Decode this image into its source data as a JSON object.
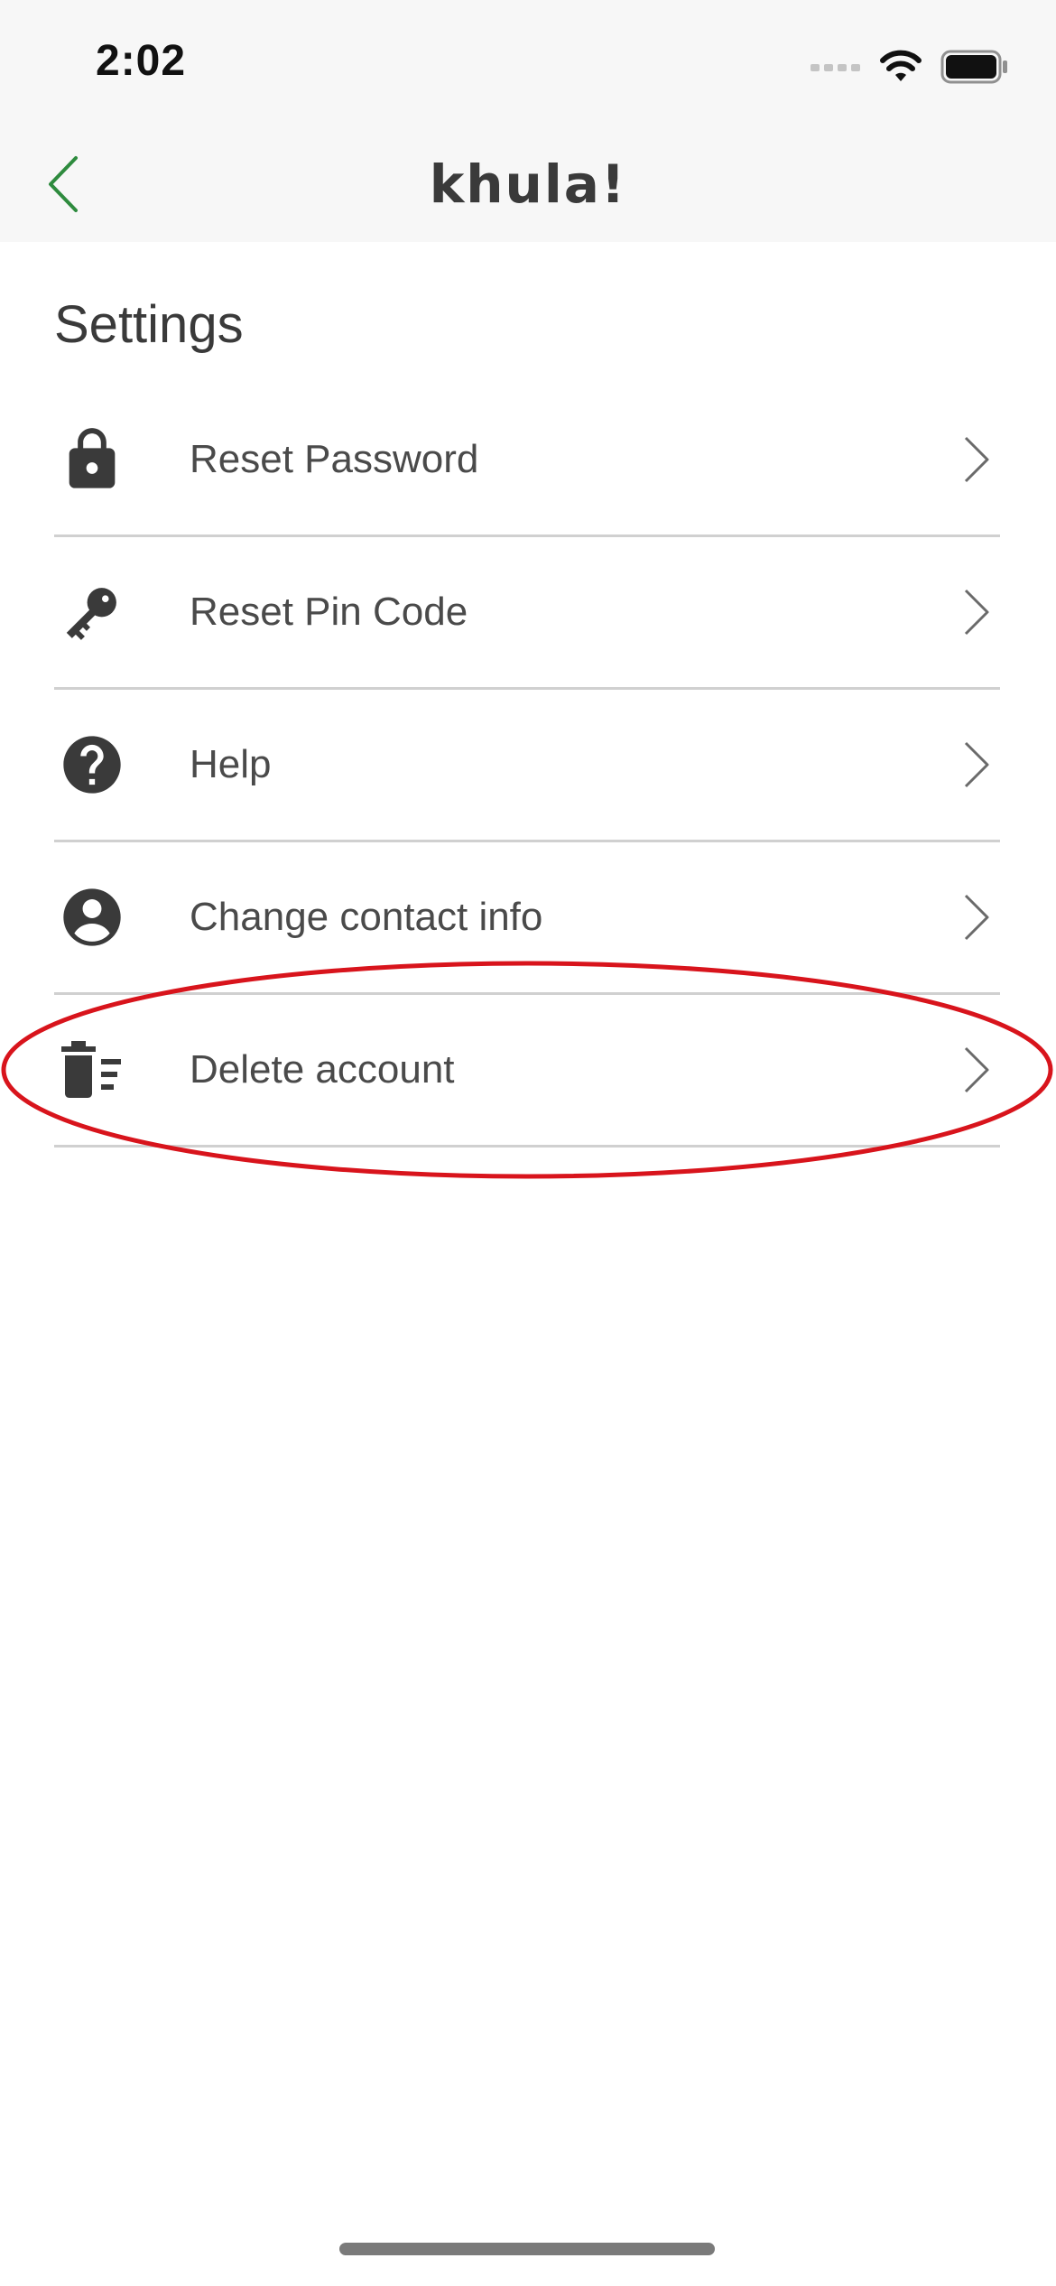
{
  "status_bar": {
    "time": "2:02"
  },
  "nav": {
    "back_icon": "chevron-left-icon",
    "brand": "khula!",
    "accent_color": "#2e8b3e"
  },
  "title": "Settings",
  "items": [
    {
      "label": "Reset Password",
      "icon": "lock-icon"
    },
    {
      "label": "Reset Pin Code",
      "icon": "key-icon"
    },
    {
      "label": "Help",
      "icon": "help-circle-icon"
    },
    {
      "label": "Change contact info",
      "icon": "account-circle-icon"
    },
    {
      "label": "Delete account",
      "icon": "delete-sweep-icon"
    }
  ],
  "highlight": {
    "target": "Delete account",
    "color": "#d8141c"
  }
}
